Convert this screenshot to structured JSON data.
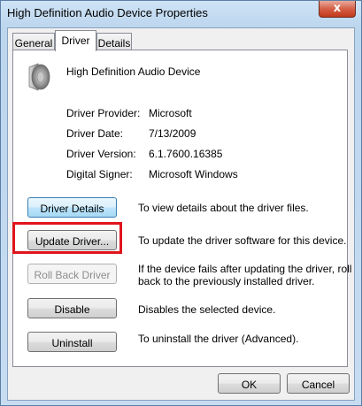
{
  "window": {
    "title": "High Definition Audio Device Properties",
    "close_glyph": "x"
  },
  "tabs": [
    {
      "label": "General",
      "selected": false
    },
    {
      "label": "Driver",
      "selected": true
    },
    {
      "label": "Details",
      "selected": false
    }
  ],
  "device": {
    "icon": "speaker-icon",
    "name": "High Definition Audio Device"
  },
  "driver_info": [
    {
      "label": "Driver Provider:",
      "value": "Microsoft"
    },
    {
      "label": "Driver Date:",
      "value": "7/13/2009"
    },
    {
      "label": "Driver Version:",
      "value": "6.1.7600.16385"
    },
    {
      "label": "Digital Signer:",
      "value": "Microsoft Windows"
    }
  ],
  "actions": {
    "details": {
      "label": "Driver Details",
      "desc": "To view details about the driver files."
    },
    "update": {
      "label": "Update Driver...",
      "desc": "To update the driver software for this device."
    },
    "rollback": {
      "label": "Roll Back Driver",
      "desc_line1": "If the device fails after updating the driver, roll",
      "desc_line2": "back to the previously installed driver."
    },
    "disable": {
      "label": "Disable",
      "desc": "Disables the selected device."
    },
    "uninstall": {
      "label": "Uninstall",
      "desc": "To uninstall the driver (Advanced)."
    }
  },
  "footer": {
    "ok": "OK",
    "cancel": "Cancel"
  },
  "colors": {
    "highlight": "#e0141c",
    "focus_border": "#3c7fb1"
  }
}
